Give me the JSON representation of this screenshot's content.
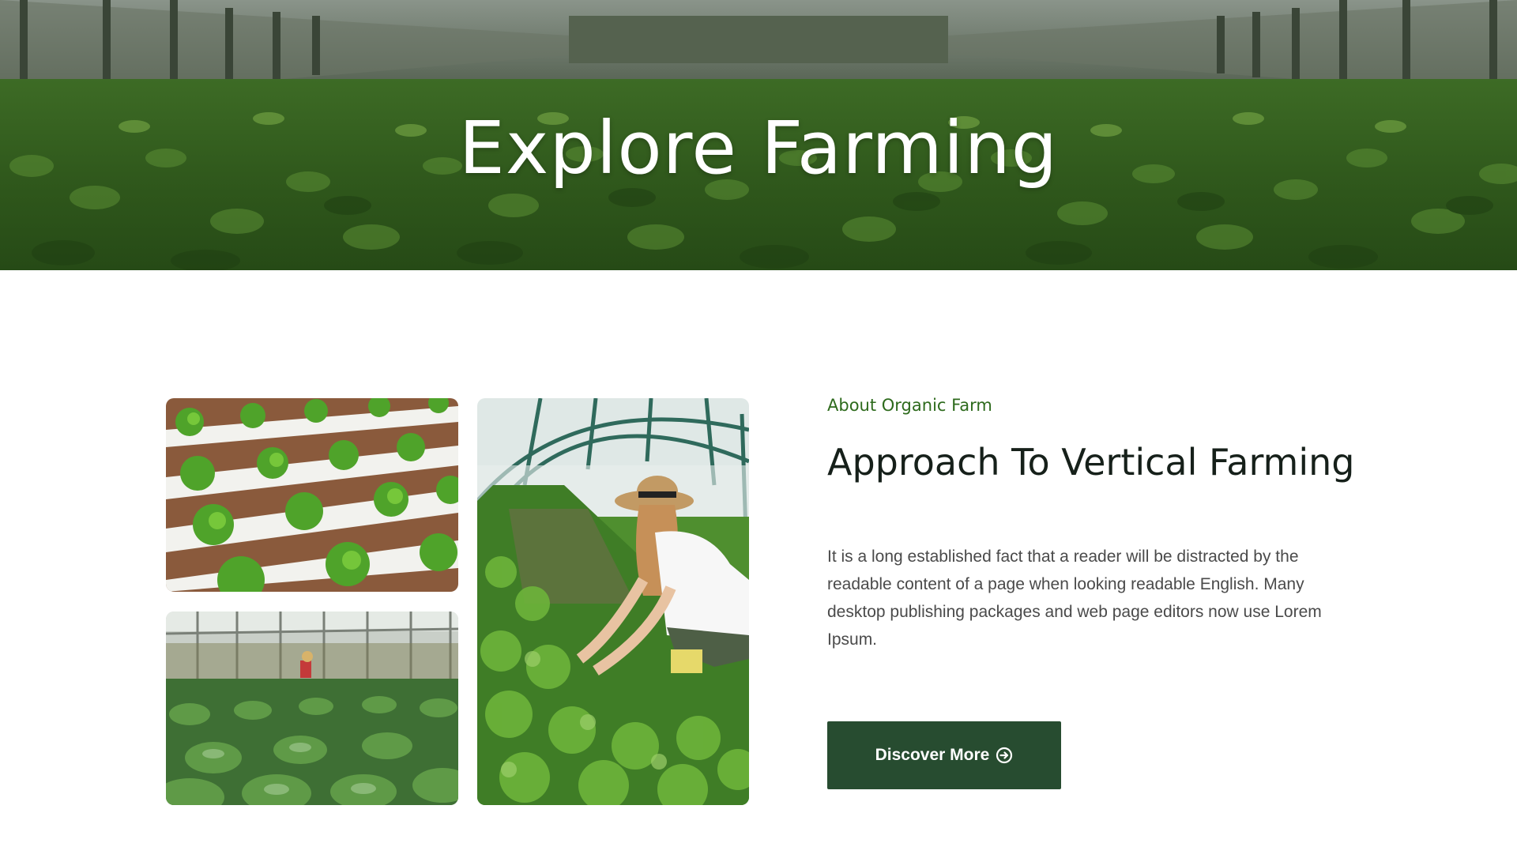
{
  "hero": {
    "title": "Explore Farming"
  },
  "gallery": {
    "images": [
      {
        "label": "hydroponic-lettuce-rows"
      },
      {
        "label": "woman-tending-plants-in-greenhouse"
      },
      {
        "label": "greenhouse-cabbage-field"
      }
    ]
  },
  "about": {
    "eyebrow": "About Organic Farm",
    "heading": "Approach To Vertical Farming",
    "body": "It is a long established fact that a reader will be distracted by the readable content of a page when looking  readable English. Many desktop publishing packages and web page editors now use Lorem Ipsum.",
    "cta_label": "Discover More",
    "cta_icon": "arrow-circle-right-icon"
  },
  "colors": {
    "brand_dark_green": "#274c30",
    "eyebrow_green": "#2d6a1c",
    "heading": "#16201a",
    "body_text": "#4a4a4a"
  }
}
